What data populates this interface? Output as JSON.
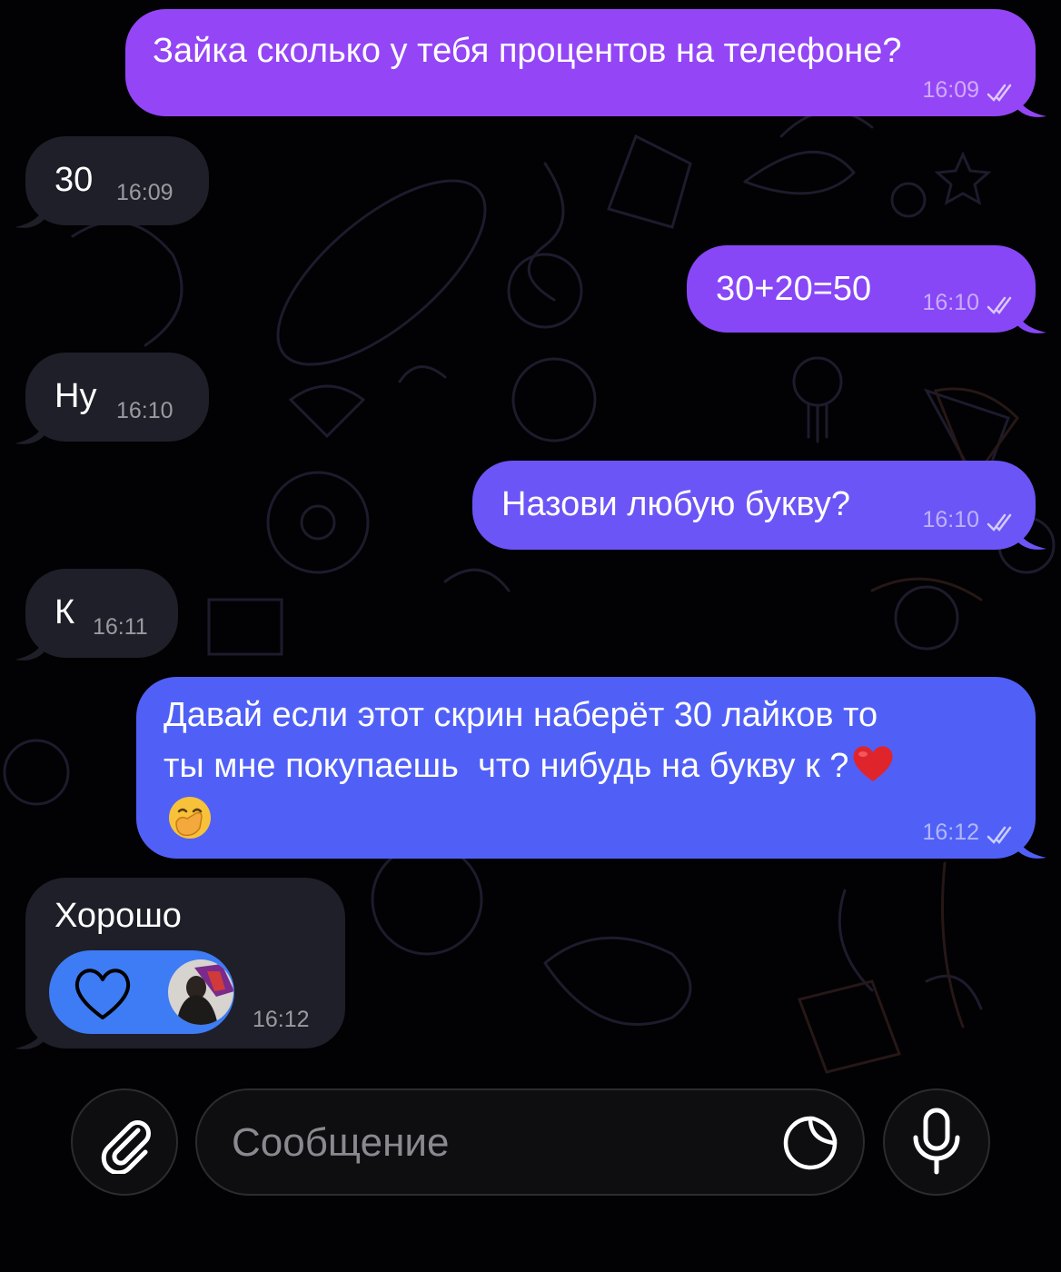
{
  "chat": {
    "messages": [
      {
        "direction": "outgoing",
        "text": "Зайка сколько у тебя процентов на телефоне?",
        "time": "16:09",
        "status": "read"
      },
      {
        "direction": "incoming",
        "text": "30",
        "time": "16:09"
      },
      {
        "direction": "outgoing",
        "text": "30+20=50",
        "time": "16:10",
        "status": "read"
      },
      {
        "direction": "incoming",
        "text": "Ну",
        "time": "16:10"
      },
      {
        "direction": "outgoing",
        "text": "Назови любую букву?",
        "time": "16:10",
        "status": "read"
      },
      {
        "direction": "incoming",
        "text": "К",
        "time": "16:11"
      },
      {
        "direction": "outgoing",
        "text_line1": "Давай если этот скрин наберёт 30 лайков то",
        "text_line2": "ты мне покупаешь  что нибудь на букву к ?",
        "emoji_after": "heart-emoji",
        "emoji_line3": "face-with-hand-over-mouth-emoji",
        "time": "16:12",
        "status": "read"
      },
      {
        "direction": "incoming",
        "text": "Хорошо",
        "time": "16:12",
        "reaction": {
          "icon": "heart-outline-icon",
          "reactor": "user-avatar"
        }
      }
    ]
  },
  "composer": {
    "placeholder": "Сообщение",
    "attach_icon": "paperclip-icon",
    "sticker_icon": "sticker-icon",
    "mic_icon": "microphone-icon"
  },
  "colors": {
    "outgoing_top": "#9a46f6",
    "outgoing_bottom": "#4b63f7",
    "incoming": "#1e1f29",
    "reaction_pill": "#3d7cf5",
    "background": "#020103"
  }
}
